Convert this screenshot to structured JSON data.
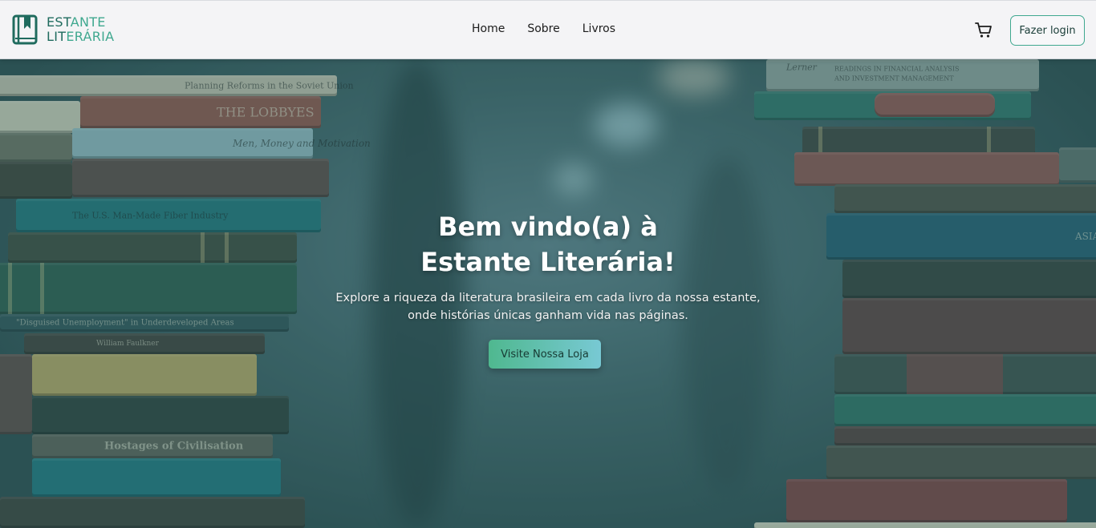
{
  "header": {
    "brand_line1": "ESTANTE",
    "brand_line2": "LITERÁRIA",
    "nav": [
      "Home",
      "Sobre",
      "Livros"
    ],
    "cart_icon": "shopping-cart-icon",
    "login_label": "Fazer login"
  },
  "hero": {
    "title_line1": "Bem vindo(a) à",
    "title_line2": "Estante Literária!",
    "subtitle_line1": "Explore a riqueza da literatura brasileira em cada livro da nossa estante,",
    "subtitle_line2": "onde histórias únicas ganham vida nas páginas.",
    "cta_label": "Visite Nossa Loja",
    "book_titles": [
      "Planning Reforms in the Soviet Union",
      "THE LOBBYES",
      "Men, Money and Motivation",
      "The U.S. Man-Made Fiber Industry",
      "\"Disguised Unemployment\" in Underdeveloped Areas",
      "William Faulkner",
      "Hostages of Civilisation",
      "Lerner",
      "READINGS IN FINANCIAL ANALYSIS",
      "AND INVESTMENT MANAGEMENT",
      "ASIA"
    ]
  },
  "colors": {
    "brand_dark": "#1f6b5e",
    "brand_light": "#3fa88f",
    "cta_start": "#4fb88f",
    "cta_end": "#78c9d4"
  }
}
